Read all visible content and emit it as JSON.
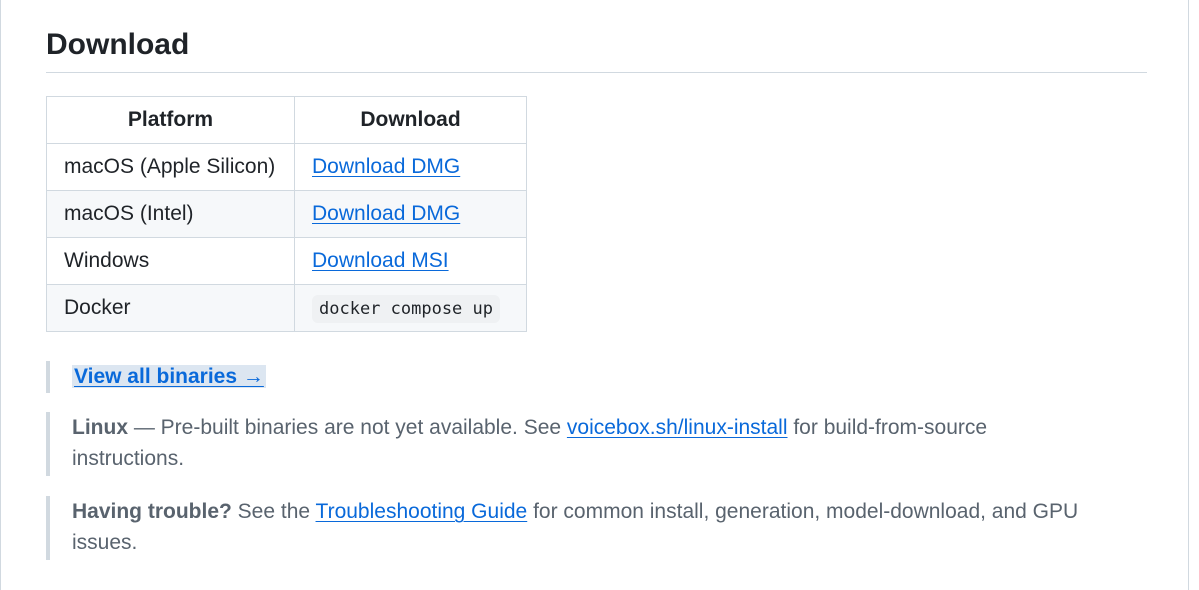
{
  "section": {
    "title": "Download"
  },
  "table": {
    "headers": [
      "Platform",
      "Download"
    ],
    "rows": [
      {
        "platform": "macOS (Apple Silicon)",
        "download": "Download DMG",
        "kind": "link"
      },
      {
        "platform": "macOS (Intel)",
        "download": "Download DMG",
        "kind": "link"
      },
      {
        "platform": "Windows",
        "download": "Download MSI",
        "kind": "link"
      },
      {
        "platform": "Docker",
        "download": "docker compose up",
        "kind": "code"
      }
    ]
  },
  "notes": {
    "binaries": {
      "link": "View all binaries →"
    },
    "linux": {
      "strong": "Linux",
      "text_before": " — Pre-built binaries are not yet available. See ",
      "link": "voicebox.sh/linux-install",
      "text_after": " for build-from-source instructions."
    },
    "trouble": {
      "strong": "Having trouble?",
      "text_before": " See the ",
      "link": "Troubleshooting Guide",
      "text_after": " for common install, generation, model-download, and GPU issues."
    }
  },
  "colors": {
    "link": "#0969da",
    "border": "#d1d9e0",
    "alt_row": "#f6f8fa",
    "muted_text": "#59636e"
  }
}
